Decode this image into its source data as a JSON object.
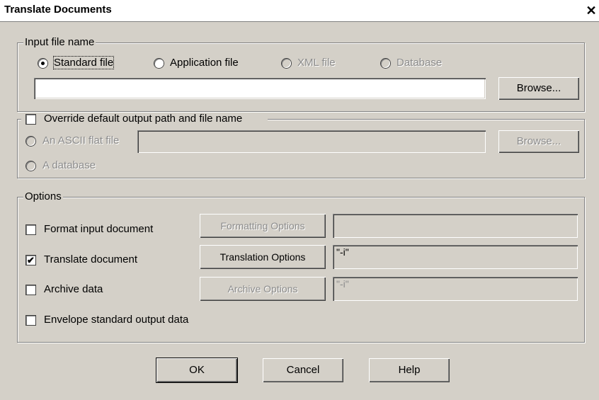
{
  "window": {
    "title": "Translate Documents",
    "close_glyph": "✕"
  },
  "input_group": {
    "legend": "Input file name",
    "radios": [
      {
        "label": "Standard file",
        "selected": true,
        "enabled": true
      },
      {
        "label": "Application file",
        "selected": false,
        "enabled": true
      },
      {
        "label": "XML file",
        "selected": false,
        "enabled": false
      },
      {
        "label": "Database",
        "selected": false,
        "enabled": false
      }
    ],
    "path_value": "",
    "browse_label": "Browse..."
  },
  "output_group": {
    "override_label": "Override default output path and file name",
    "override_checked": false,
    "ascii_label": "An ASCII flat file",
    "ascii_path_value": "",
    "browse_label": "Browse...",
    "database_label": "A database"
  },
  "options_group": {
    "legend": "Options",
    "format_label": "Format input document",
    "format_checked": false,
    "formatting_options_label": "Formatting Options",
    "formatting_value": "",
    "translate_label": "Translate document",
    "translate_checked": true,
    "translation_options_label": "Translation Options",
    "translation_value": "\"-i\"",
    "archive_label": "Archive data",
    "archive_checked": false,
    "archive_options_label": "Archive Options",
    "archive_value": "\"-i\"",
    "envelope_label": "Envelope standard output data",
    "envelope_checked": false
  },
  "buttons": {
    "ok": "OK",
    "cancel": "Cancel",
    "help": "Help"
  },
  "glyphs": {
    "check": "✔"
  }
}
